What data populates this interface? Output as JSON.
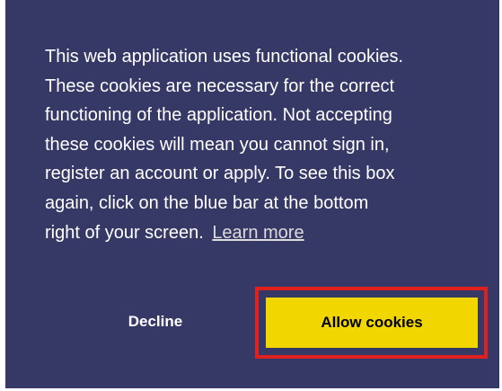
{
  "cookie_banner": {
    "message_lines": [
      "This web application uses functional cookies.",
      "These cookies are necessary for the correct",
      "functioning of the application. Not accepting",
      "these cookies will mean you cannot sign in,",
      "register an account or apply. To see this box",
      "again, click on the blue bar at the bottom",
      "right of your screen."
    ],
    "learn_more_label": "Learn more",
    "decline_label": "Decline",
    "allow_label": "Allow cookies"
  },
  "colors": {
    "banner_background": "#363866",
    "allow_button": "#f1d600",
    "highlight_outline": "#e0201e",
    "text": "#ffffff"
  }
}
